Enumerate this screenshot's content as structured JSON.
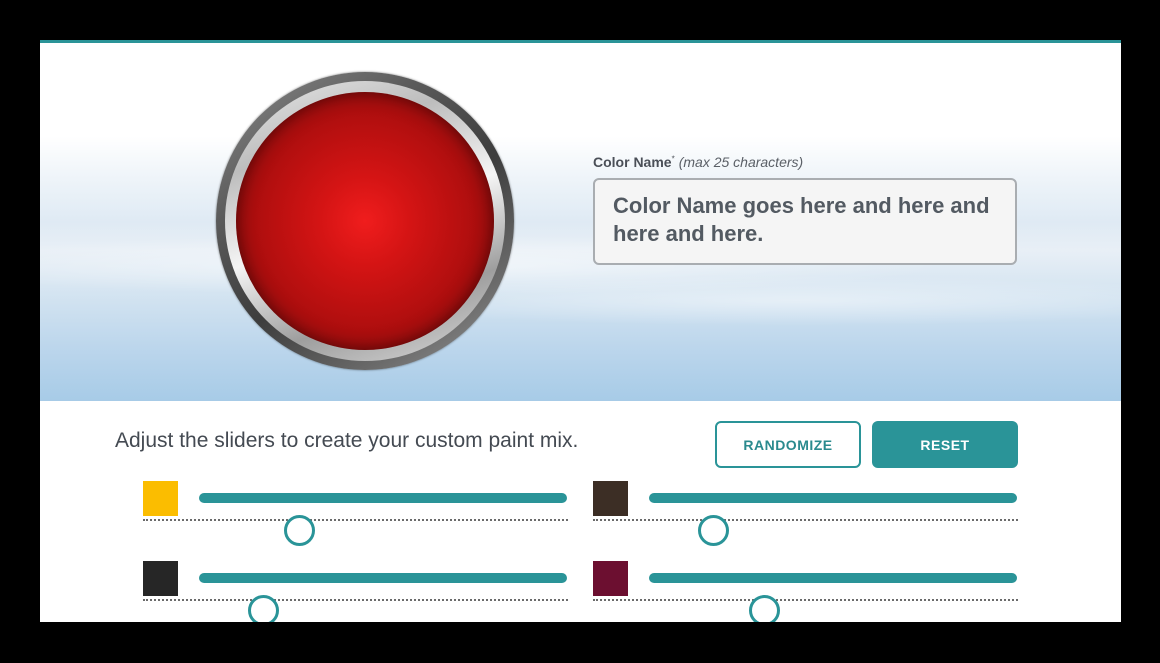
{
  "color_name": {
    "label": "Color Name",
    "required_mark": "*",
    "hint": "(max 25 characters)",
    "value": "Color Name goes here and here and here and here."
  },
  "swatch": {
    "color": "#d41414"
  },
  "instructions": "Adjust the sliders to create your custom paint mix.",
  "buttons": {
    "randomize": "RANDOMIZE",
    "reset": "RESET"
  },
  "accent_color": "#2a9498",
  "sliders": [
    {
      "name": "yellow",
      "color": "#fbbd00",
      "value": 0.27
    },
    {
      "name": "dark-brown",
      "color": "#3c2e25",
      "value": 0.17
    },
    {
      "name": "black",
      "color": "#262626",
      "value": 0.17
    },
    {
      "name": "burgundy",
      "color": "#6c0f30",
      "value": 0.31
    }
  ]
}
